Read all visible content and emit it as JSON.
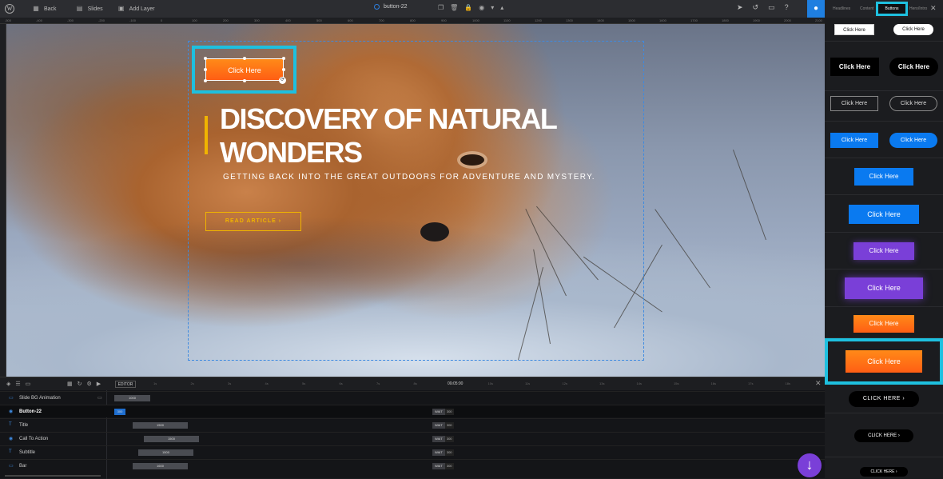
{
  "topbar": {
    "wp_logo": "W",
    "back": "Back",
    "slides": "Slides",
    "add_layer": "Add Layer",
    "layer_name": "button-22",
    "icons": [
      "copy-icon",
      "trash-icon",
      "lock-icon",
      "eye-icon",
      "chevron-down-icon",
      "chevron-up-icon"
    ],
    "right_icons": [
      "cursor-icon",
      "undo-icon",
      "desktop-icon",
      "help-icon"
    ],
    "drop_icon": "droplet-icon"
  },
  "ruler": {
    "ticks": [
      "-500",
      "-400",
      "-300",
      "-200",
      "-100",
      "0",
      "100",
      "200",
      "300",
      "400",
      "500",
      "600",
      "700",
      "800",
      "900",
      "1000",
      "1100",
      "1200",
      "1300",
      "1400",
      "1500",
      "1600",
      "1700",
      "1800",
      "1900",
      "2000",
      "2100",
      "2200"
    ]
  },
  "slide": {
    "button_label": "Click Here",
    "title": "DISCOVERY OF NATURAL WONDERS",
    "subtitle": "GETTING BACK INTO THE GREAT OUTDOORS FOR ADVENTURE AND MYSTERY.",
    "cta": "READ ARTICLE  ›"
  },
  "timeline": {
    "editor_tag": "EDITOR",
    "time": "00:05:00",
    "seconds": [
      "1s",
      "2s",
      "3s",
      "4s",
      "5s",
      "6s",
      "7s",
      "8s",
      "9s",
      "10s",
      "11s",
      "12s",
      "13s",
      "14s",
      "15s",
      "16s",
      "17s",
      "18s"
    ],
    "rows": [
      {
        "label": "Slide BG Animation",
        "bar": "1000",
        "wait": "",
        "wait_val": ""
      },
      {
        "label": "Button-22",
        "bar": "300",
        "wait": "WAIT",
        "wait_val": "300"
      },
      {
        "label": "Title",
        "bar": "1500",
        "wait": "WAIT",
        "wait_val": "300"
      },
      {
        "label": "Call To Action",
        "bar": "1500",
        "wait": "WAIT",
        "wait_val": "300"
      },
      {
        "label": "Subtitle",
        "bar": "1500",
        "wait": "WAIT",
        "wait_val": "300"
      },
      {
        "label": "Bar",
        "bar": "1600",
        "wait": "WAIT",
        "wait_val": "300"
      }
    ]
  },
  "panel": {
    "tabs": [
      "Headlines",
      "Content",
      "Buttons",
      "Hero/Intro"
    ],
    "active_tab": "Buttons",
    "button_label": "Click Here",
    "button_label_caps": "CLICK HERE"
  },
  "colors": {
    "accent": "#1ec0df",
    "orange": "#ff6a14",
    "blue": "#0a7af0",
    "purple": "#7a3fd8",
    "yellow": "#f0b400"
  }
}
